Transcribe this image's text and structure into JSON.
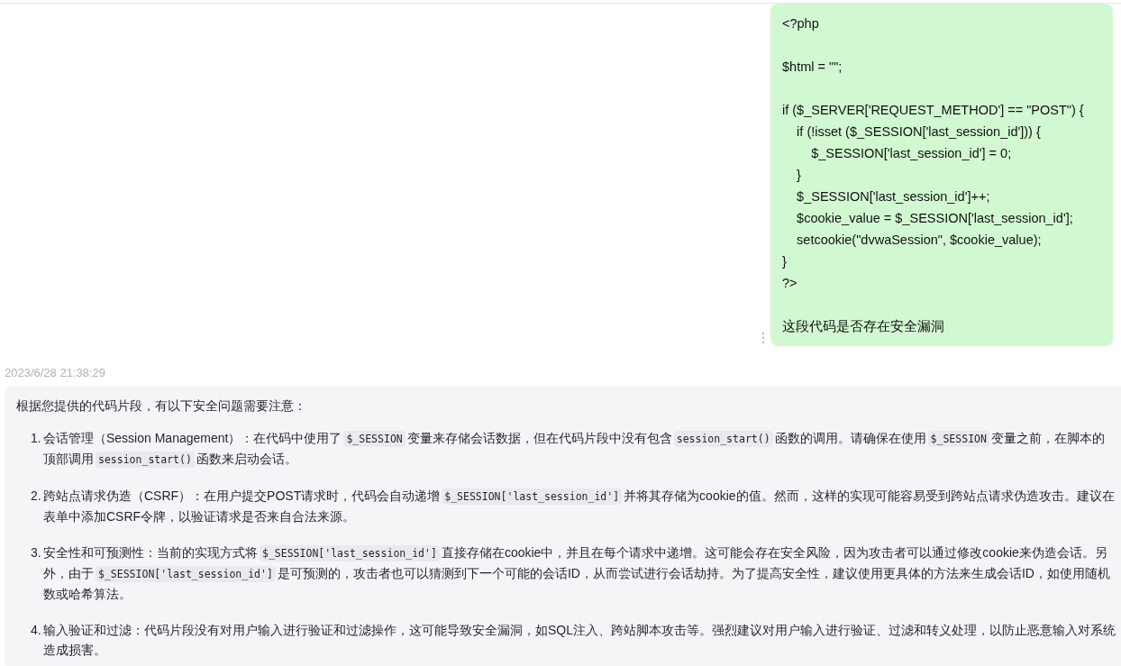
{
  "user_message": {
    "code_blocks": [
      [
        "<?php"
      ],
      [
        "$html = \"\";"
      ],
      [
        "if ($_SERVER['REQUEST_METHOD'] == \"POST\") {",
        "    if (!isset ($_SESSION['last_session_id'])) {",
        "        $_SESSION['last_session_id'] = 0;",
        "    }",
        "    $_SESSION['last_session_id']++;",
        "    $cookie_value = $_SESSION['last_session_id'];",
        "    setcookie(\"dvwaSession\", $cookie_value);",
        "}",
        "?>"
      ]
    ],
    "question": "这段代码是否存在安全漏洞"
  },
  "timestamp": "2023/6/28 21:38:29",
  "answer": {
    "intro": "根据您提供的代码片段，有以下安全问题需要注意：",
    "items": [
      {
        "number": "1.",
        "segments": [
          {
            "kind": "text",
            "text": "会话管理（Session Management）：在代码中使用了"
          },
          {
            "kind": "code",
            "text": "$_SESSION"
          },
          {
            "kind": "text",
            "text": "变量来存储会话数据，但在代码片段中没有包含"
          },
          {
            "kind": "code",
            "text": "session_start()"
          },
          {
            "kind": "text",
            "text": "函数的调用。请确保在使用"
          },
          {
            "kind": "code",
            "text": "$_SESSION"
          },
          {
            "kind": "text",
            "text": "变量之前，在脚本的顶部调用"
          },
          {
            "kind": "code",
            "text": "session_start()"
          },
          {
            "kind": "text",
            "text": "函数来启动会话。"
          }
        ]
      },
      {
        "number": "2.",
        "segments": [
          {
            "kind": "text",
            "text": "跨站点请求伪造（CSRF）：在用户提交POST请求时，代码会自动递增"
          },
          {
            "kind": "code",
            "text": "$_SESSION['last_session_id']"
          },
          {
            "kind": "text",
            "text": "并将其存储为cookie的值。然而，这样的实现可能容易受到跨站点请求伪造攻击。建议在表单中添加CSRF令牌，以验证请求是否来自合法来源。"
          }
        ]
      },
      {
        "number": "3.",
        "segments": [
          {
            "kind": "text",
            "text": "安全性和可预测性：当前的实现方式将"
          },
          {
            "kind": "code",
            "text": "$_SESSION['last_session_id']"
          },
          {
            "kind": "text",
            "text": "直接存储在cookie中，并且在每个请求中递增。这可能会存在安全风险，因为攻击者可以通过修改cookie来伪造会话。另外，由于"
          },
          {
            "kind": "code",
            "text": "$_SESSION['last_session_id']"
          },
          {
            "kind": "text",
            "text": "是可预测的，攻击者也可以猜测到下一个可能的会话ID，从而尝试进行会话劫持。为了提高安全性，建议使用更具体的方法来生成会话ID，如使用随机数或哈希算法。"
          }
        ]
      },
      {
        "number": "4.",
        "segments": [
          {
            "kind": "text",
            "text": "输入验证和过滤：代码片段没有对用户输入进行验证和过滤操作，这可能导致安全漏洞，如SQL注入、跨站脚本攻击等。强烈建议对用户输入进行验证、过滤和转义处理，以防止恶意输入对系统造成损害。"
          }
        ]
      }
    ]
  }
}
